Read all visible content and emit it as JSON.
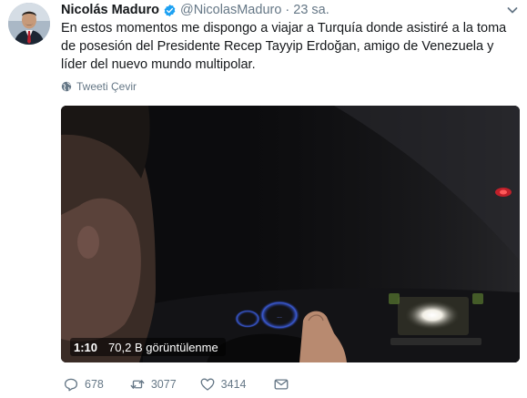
{
  "tweet": {
    "author_name": "Nicolás Maduro",
    "handle": "@NicolasMaduro",
    "separator": "·",
    "time": "23 sa.",
    "text": "En estos momentos me dispongo a viajar a Turquía donde asistiré a la toma de posesión del Presidente Recep Tayyip Erdoğan, amigo de Venezuela y líder del nuevo mundo multipolar.",
    "translate_label": "Tweeti Çevir"
  },
  "video": {
    "duration": "1:10",
    "views": "70,2 B görüntülenme"
  },
  "actions": {
    "replies": "678",
    "retweets": "3077",
    "likes": "3414"
  },
  "icons": {
    "verified": "verified-badge-icon",
    "caret": "chevron-down-icon",
    "translate": "globe-icon",
    "reply": "reply-icon",
    "retweet": "retweet-icon",
    "like": "heart-icon",
    "dm": "envelope-icon"
  },
  "colors": {
    "verified_blue": "#1da1f2",
    "secondary_text": "#657786",
    "primary_text": "#14171a"
  }
}
